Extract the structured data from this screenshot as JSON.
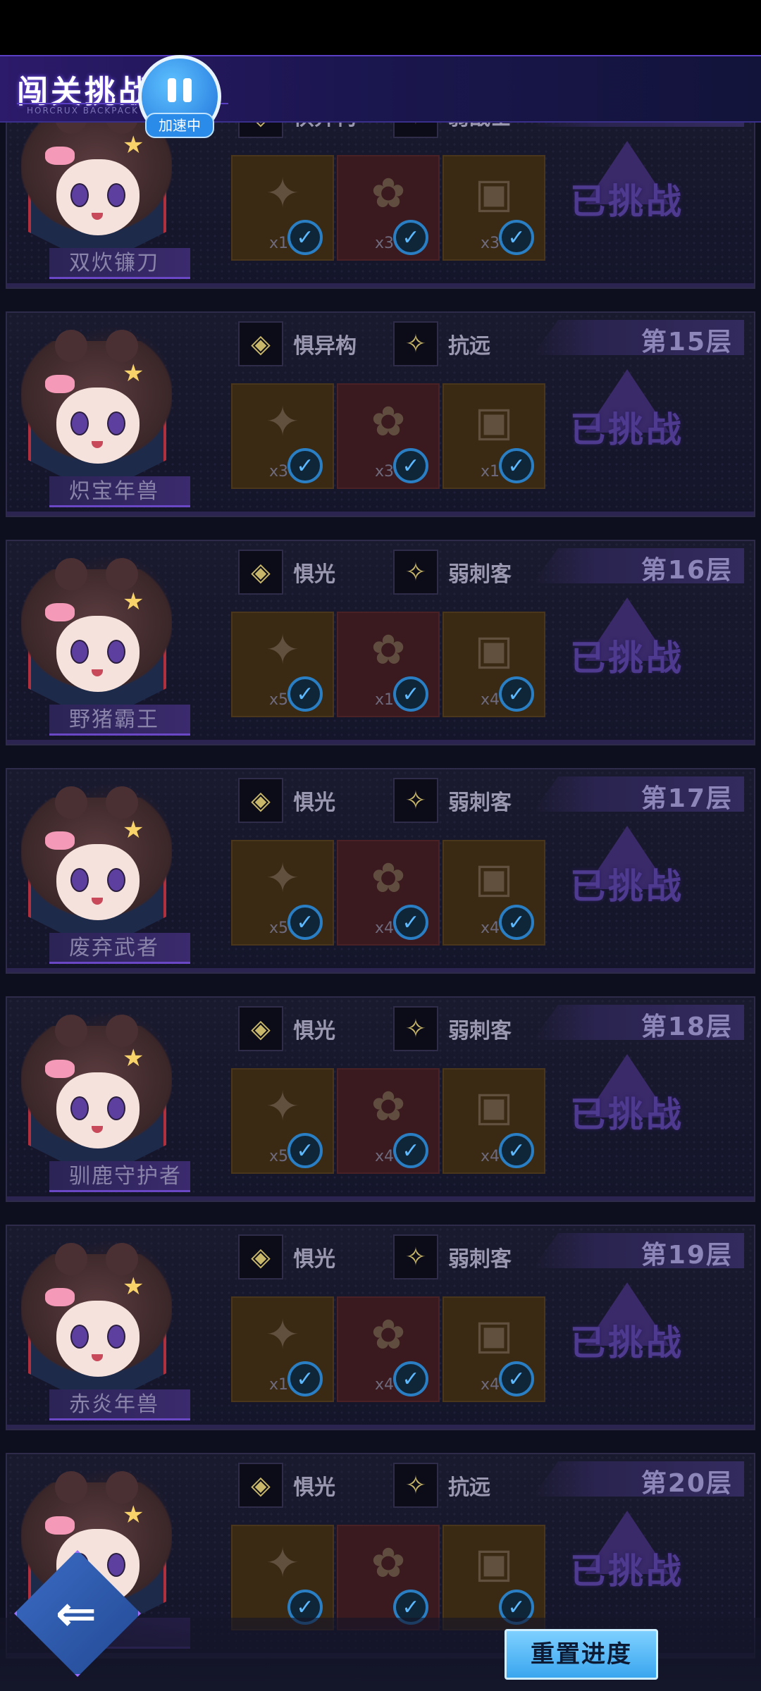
{
  "header": {
    "title": "闯关挑战",
    "subtitle": "HORCRUX BACKPACK",
    "speed_label": "加速中"
  },
  "floors": [
    {
      "floor": "",
      "boss": "双炊镰刀",
      "trait1": "惧异构",
      "trait2": "弱战士",
      "rewards": [
        "x1",
        "x30",
        "x30"
      ],
      "status": "已挑战"
    },
    {
      "floor": "第15层",
      "boss": "炽宝年兽",
      "trait1": "惧异构",
      "trait2": "抗远",
      "rewards": [
        "x3",
        "x30",
        "x1"
      ],
      "status": "已挑战"
    },
    {
      "floor": "第16层",
      "boss": "野猪霸王",
      "trait1": "惧光",
      "trait2": "弱刺客",
      "rewards": [
        "x5",
        "x1",
        "x40"
      ],
      "status": "已挑战"
    },
    {
      "floor": "第17层",
      "boss": "废弃武者",
      "trait1": "惧光",
      "trait2": "弱刺客",
      "rewards": [
        "x5",
        "x40",
        "x40"
      ],
      "status": "已挑战"
    },
    {
      "floor": "第18层",
      "boss": "驯鹿守护者",
      "trait1": "惧光",
      "trait2": "弱刺客",
      "rewards": [
        "x5",
        "x40",
        "x40"
      ],
      "status": "已挑战"
    },
    {
      "floor": "第19层",
      "boss": "赤炎年兽",
      "trait1": "惧光",
      "trait2": "弱刺客",
      "rewards": [
        "x1",
        "x40",
        "x40"
      ],
      "status": "已挑战"
    },
    {
      "floor": "第20层",
      "boss": "",
      "trait1": "惧光",
      "trait2": "抗远",
      "rewards": [
        "",
        "",
        ""
      ],
      "status": "已挑战"
    }
  ],
  "footer": {
    "reset_label": "重置进度"
  }
}
